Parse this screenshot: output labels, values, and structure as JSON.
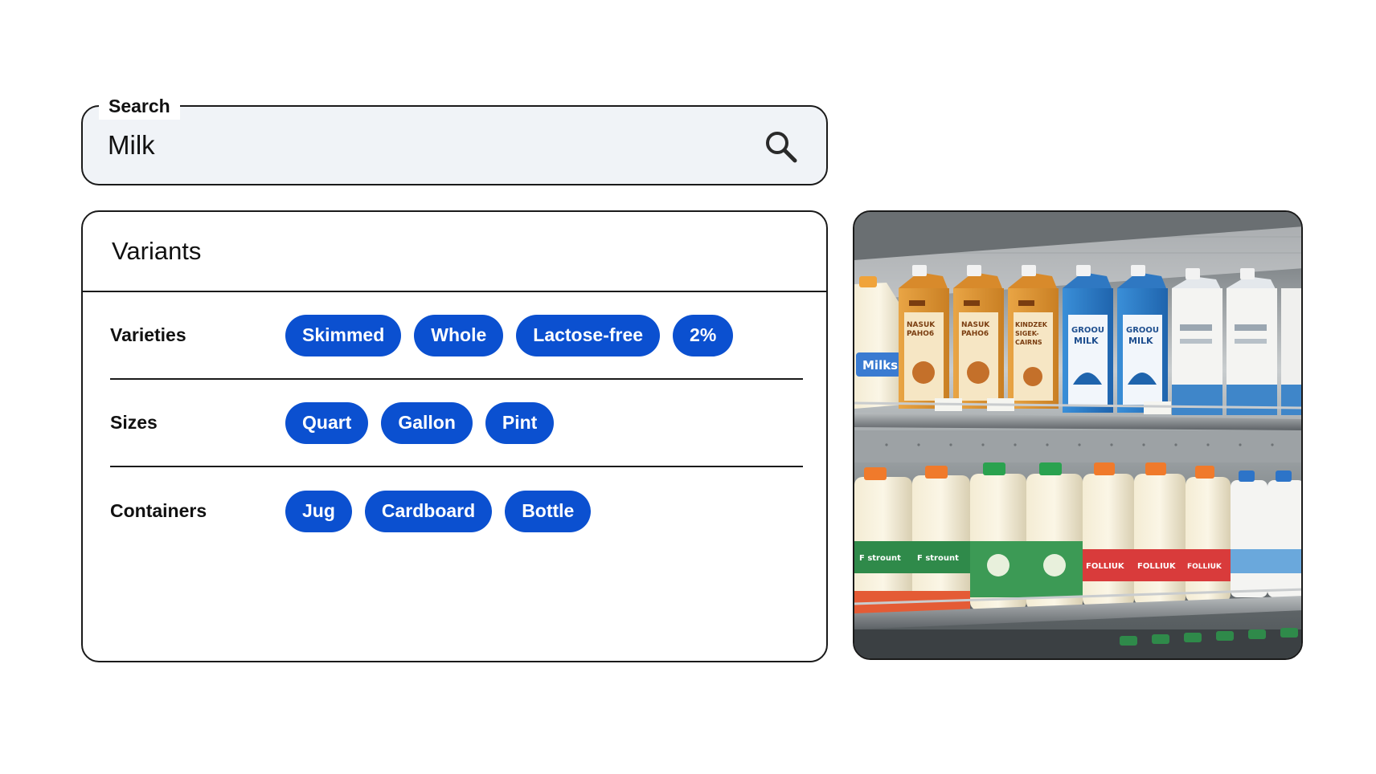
{
  "search": {
    "legend": "Search",
    "value": "Milk",
    "icon": "search-icon"
  },
  "variants": {
    "title": "Variants",
    "rows": [
      {
        "label": "Varieties",
        "chips": [
          "Skimmed",
          "Whole",
          "Lactose-free",
          "2%"
        ]
      },
      {
        "label": "Sizes",
        "chips": [
          "Quart",
          "Gallon",
          "Pint"
        ]
      },
      {
        "label": "Containers",
        "chips": [
          "Jug",
          "Cardboard",
          "Bottle"
        ]
      }
    ]
  },
  "photo": {
    "subject": "milk-shelf-photo",
    "carton_labels": {
      "left_jug": "Milks",
      "orange": [
        "NASUK PAHO6",
        "NASUK PAHO6",
        "KINDZEK SIGEK- CAIRNS"
      ],
      "blue": [
        "GROOU MILK",
        "GROOU MILK"
      ],
      "bottom_green": [
        "F strount",
        "F strount"
      ],
      "bottom_red": [
        "FOLLIUK",
        "FOLLIUK",
        "FOLLIUK"
      ]
    }
  },
  "colors": {
    "chip_bg": "#0b50d0",
    "chip_text": "#ffffff",
    "border": "#1a1a1a",
    "search_bg": "#f0f3f7"
  }
}
